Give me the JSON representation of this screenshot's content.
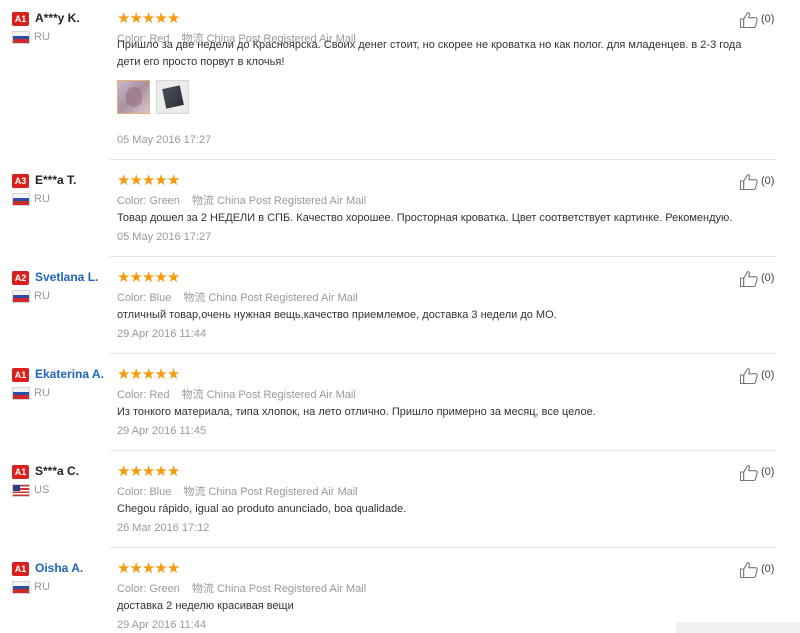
{
  "colors": {
    "star": "#f59a0b",
    "badge": "#d9201c",
    "link": "#1f64b9"
  },
  "color_label": "Color:",
  "reviews": [
    {
      "badge": "A1",
      "name": "A***y K.",
      "name_link": false,
      "country": "RU",
      "flag": "flag-ru",
      "stars": 5,
      "color_value": "Red",
      "shipping": "物流 China Post Registered Air Mail",
      "text": "Пришло за две недели до Красноярска. Своих денег стоит, но скорее не кроватка но как полог. для младенцев. в 2-3 года дети его просто порвут в клочья!",
      "has_photos": true,
      "date": "05 May 2016 17:27",
      "likes": "(0)"
    },
    {
      "badge": "A3",
      "name": "E***a T.",
      "name_link": false,
      "country": "RU",
      "flag": "flag-ru",
      "stars": 5,
      "color_value": "Green",
      "shipping": "物流 China Post Registered Air Mail",
      "text": "Товар дошел за 2 НЕДЕЛИ в СПБ. Качество хорошее. Просторная кроватка. Цвет соответствует картинке. Рекомендую.",
      "date": "05 May 2016 17:27",
      "likes": "(0)"
    },
    {
      "badge": "A2",
      "name": "Svetlana L.",
      "name_link": true,
      "country": "RU",
      "flag": "flag-ru",
      "stars": 5,
      "color_value": "Blue",
      "shipping": "物流 China Post Registered Air Mail",
      "text": "отличный товар,очень нужная вещь,качество приемлемое, доставка 3 недели до МО.",
      "date": "29 Apr 2016 11:44",
      "likes": "(0)"
    },
    {
      "badge": "A1",
      "name": "Ekaterina A.",
      "name_link": true,
      "country": "RU",
      "flag": "flag-ru",
      "stars": 5,
      "color_value": "Red",
      "shipping": "物流 China Post Registered Air Mail",
      "text": "Из тонкого материала, типа хлопок, на лето отлично. Пришло примерно за месяц, все целое.",
      "date": "29 Apr 2016 11:45",
      "likes": "(0)"
    },
    {
      "badge": "A1",
      "name": "S***a C.",
      "name_link": false,
      "country": "US",
      "flag": "flag-us",
      "stars": 5,
      "color_value": "Blue",
      "shipping": "物流 China Post Registered Air Mail",
      "text": "Chegou rápido, igual ao produto anunciado, boa qualidade.",
      "date": "26 Mar 2016 17:12",
      "likes": "(0)"
    },
    {
      "badge": "A1",
      "name": "Oisha A.",
      "name_link": true,
      "country": "RU",
      "flag": "flag-ru",
      "stars": 5,
      "color_value": "Green",
      "shipping": "物流 China Post Registered Air Mail",
      "text": "доставка 2 неделю красивая вещи",
      "date": "29 Apr 2016 11:44",
      "likes": "(0)"
    }
  ]
}
